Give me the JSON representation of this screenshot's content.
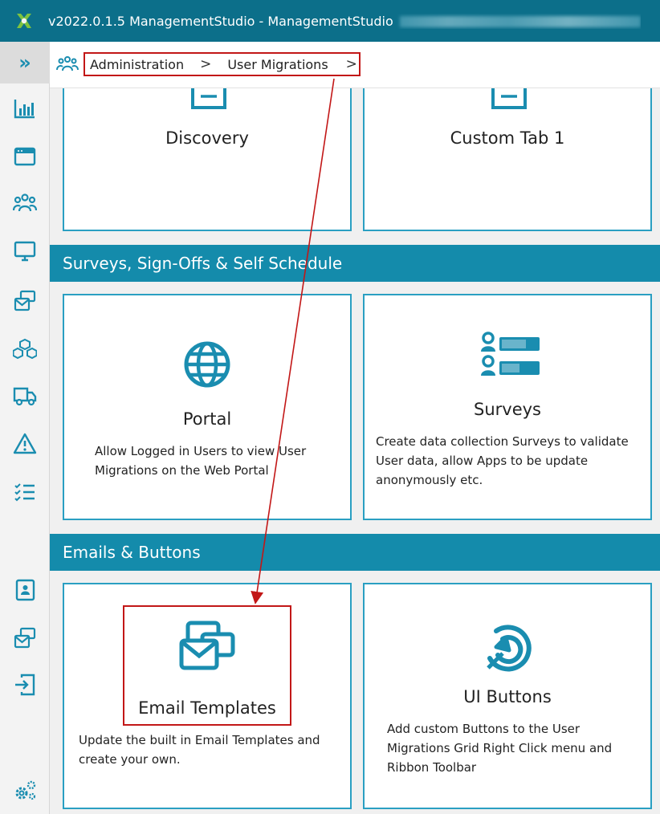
{
  "window": {
    "title": "v2022.0.1.5 ManagementStudio - ManagementStudio",
    "app_icon": "managementstudio-logo-icon"
  },
  "rail": {
    "expand_label": "»",
    "items": [
      {
        "icon": "bar-chart-icon"
      },
      {
        "icon": "browser-window-icon"
      },
      {
        "icon": "users-group-icon"
      },
      {
        "icon": "monitor-icon"
      },
      {
        "icon": "mail-stack-icon"
      },
      {
        "icon": "cubes-icon"
      },
      {
        "icon": "delivery-truck-icon"
      },
      {
        "icon": "warning-triangle-icon"
      },
      {
        "icon": "checklist-icon"
      },
      {
        "icon": "contact-card-icon"
      },
      {
        "icon": "mail-stack-icon"
      },
      {
        "icon": "import-icon"
      },
      {
        "icon": "settings-gears-icon"
      }
    ]
  },
  "breadcrumb": {
    "items": [
      "Administration",
      "User Migrations"
    ],
    "separator": ">"
  },
  "cards_top": [
    {
      "title": "Discovery"
    },
    {
      "title": "Custom Tab 1"
    }
  ],
  "section_surveys": {
    "label": "Surveys, Sign-Offs & Self Schedule"
  },
  "card_portal": {
    "title": "Portal",
    "desc_line1": "Allow Logged in Users to view User",
    "desc_line2": "Migrations on the Web Portal"
  },
  "card_surveys": {
    "title": "Surveys",
    "desc_line1": "Create data collection Surveys to validate",
    "desc_line2": "User data, allow Apps to be update",
    "desc_line3": "anonymously etc."
  },
  "section_emails": {
    "label": "Emails & Buttons"
  },
  "card_email": {
    "title": "Email Templates",
    "desc_line1": "Update the built in Email Templates and",
    "desc_line2": "create your own."
  },
  "card_ui": {
    "title": "UI Buttons",
    "desc_line1": "Add custom Buttons to the User",
    "desc_line2": "Migrations Grid Right Click menu and",
    "desc_line3": "Ribbon Toolbar"
  },
  "colors": {
    "titlebar": "#0c6f8a",
    "accent": "#148bab",
    "card_border": "#2a9fc2",
    "highlight": "#c21717"
  }
}
